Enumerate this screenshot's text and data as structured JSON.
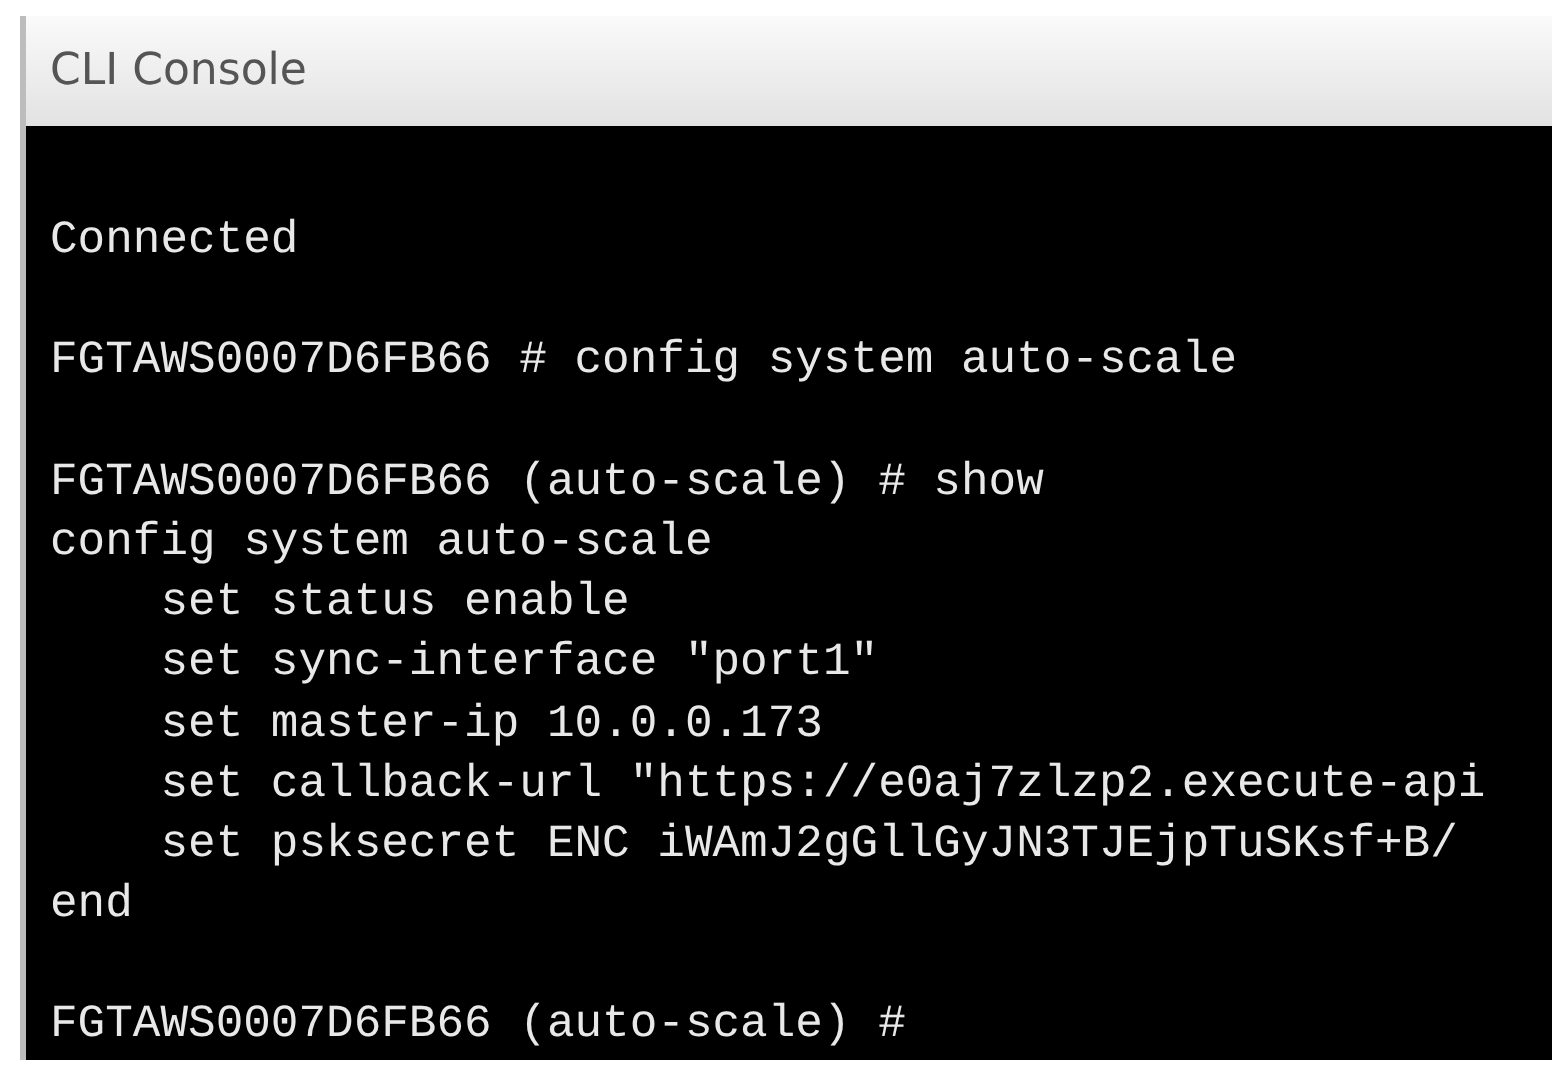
{
  "window": {
    "title": "CLI Console"
  },
  "console": {
    "lines": [
      {
        "text": "Connected",
        "blank_before": false
      },
      {
        "text": "FGTAWS0007D6FB66 # config system auto-scale",
        "blank_before": true
      },
      {
        "text": "FGTAWS0007D6FB66 (auto-scale) # show",
        "blank_before": true
      },
      {
        "text": "config system auto-scale",
        "blank_before": false
      },
      {
        "text": "    set status enable",
        "blank_before": false
      },
      {
        "text": "    set sync-interface \"port1\"",
        "blank_before": false
      },
      {
        "text": "    set master-ip 10.0.0.173",
        "blank_before": false
      },
      {
        "text": "    set callback-url \"https://e0aj7zlzp2.execute-api",
        "blank_before": false
      },
      {
        "text": "    set psksecret ENC iWAmJ2gGllGyJN3TJEjpTuSKsf+B/",
        "blank_before": false
      },
      {
        "text": "end",
        "blank_before": false
      },
      {
        "text": "FGTAWS0007D6FB66 (auto-scale) #",
        "blank_before": true
      }
    ]
  }
}
